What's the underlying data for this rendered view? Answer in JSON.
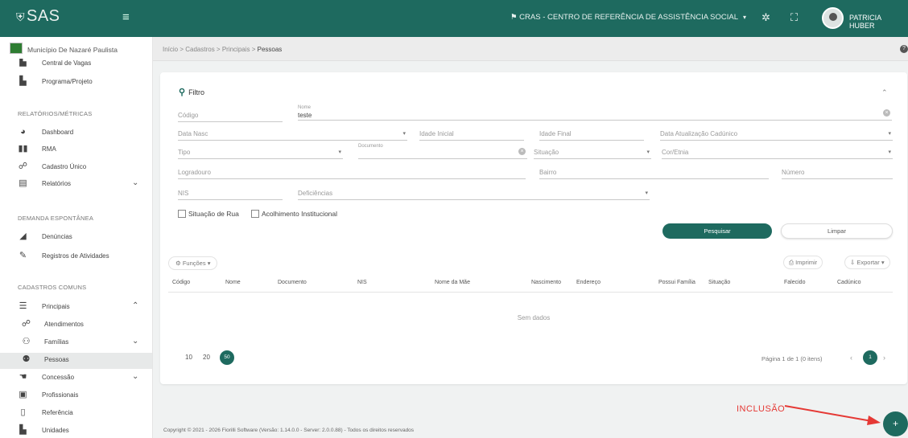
{
  "app": {
    "logo_text": "SAS",
    "unit": "CRAS - CENTRO DE REFERÊNCIA DE ASSISTÊNCIA SOCIAL",
    "user": "PATRICIA HUBER"
  },
  "sidebar": {
    "municipality": "Município De Nazaré Paulista",
    "top_items": [
      {
        "label": "Central de Vagas",
        "icon": "building-icon"
      },
      {
        "label": "Programa/Projeto",
        "icon": "building-icon"
      }
    ],
    "section_reports": "RELATÓRIOS/MÉTRICAS",
    "report_items": [
      {
        "label": "Dashboard",
        "icon": "pie-chart-icon"
      },
      {
        "label": "RMA",
        "icon": "bar-chart-icon"
      },
      {
        "label": "Cadastro Único",
        "icon": "handshake-icon"
      },
      {
        "label": "Relatórios",
        "icon": "clipboard-icon"
      }
    ],
    "section_demand": "DEMANDA ESPONTÂNEA",
    "demand_items": [
      {
        "label": "Denúncias",
        "icon": "megaphone-icon"
      },
      {
        "label": "Registros de Atividades",
        "icon": "pen-icon"
      }
    ],
    "section_common": "CADASTROS COMUNS",
    "common_items": [
      {
        "label": "Principais",
        "icon": "list-icon"
      },
      {
        "label": "Atendimentos",
        "icon": "handshake-icon"
      },
      {
        "label": "Famílias",
        "icon": "family-icon"
      },
      {
        "label": "Pessoas",
        "icon": "people-icon"
      },
      {
        "label": "Concessão",
        "icon": "hand-icon"
      },
      {
        "label": "Profissionais",
        "icon": "id-card-icon"
      },
      {
        "label": "Referência",
        "icon": "document-icon"
      },
      {
        "label": "Unidades",
        "icon": "building-icon"
      }
    ]
  },
  "breadcrumb": {
    "path": "Início > Cadastros > Principais > ",
    "current": "Pessoas"
  },
  "filter": {
    "title": "Filtro",
    "fields": {
      "codigo": "Código",
      "nome_label": "Nome",
      "nome_value": "teste",
      "data_nasc": "Data Nasc",
      "idade_inicial": "Idade Inicial",
      "idade_final": "Idade Final",
      "data_atualizacao": "Data Atualização Cadúnico",
      "tipo": "Tipo",
      "documento": "Documento",
      "situacao": "Situação",
      "cor_etnia": "Cor/Etnia",
      "logradouro": "Logradouro",
      "bairro": "Bairro",
      "numero": "Número",
      "nis": "NIS",
      "deficiencias": "Deficiências"
    },
    "checkboxes": [
      "Situação de Rua",
      "Acolhimento Institucional"
    ],
    "search_button": "Pesquisar",
    "clear_button": "Limpar"
  },
  "toolbar": {
    "functions": "Funções",
    "print": "Imprimir",
    "export": "Exportar"
  },
  "table": {
    "columns": [
      "Código",
      "Nome",
      "Documento",
      "NIS",
      "Nome da Mãe",
      "Nascimento",
      "Endereço",
      "Possui Família",
      "Situação",
      "Falecido",
      "Cadúnico"
    ],
    "empty": "Sem dados"
  },
  "pagination": {
    "sizes": [
      "10",
      "20",
      "50"
    ],
    "info": "Página 1 de 1 (0 itens)",
    "current": "1"
  },
  "footer": "Copyright © 2021 - 2026 Fiorilli Software (Versão: 1.14.0.0 - Server: 2.0.0.88) - Todos os direitos reservados",
  "annotation": "INCLUSÃO",
  "fab_symbol": "+",
  "colors": {
    "primary": "#1e6a5f",
    "annotation": "#e53935"
  }
}
